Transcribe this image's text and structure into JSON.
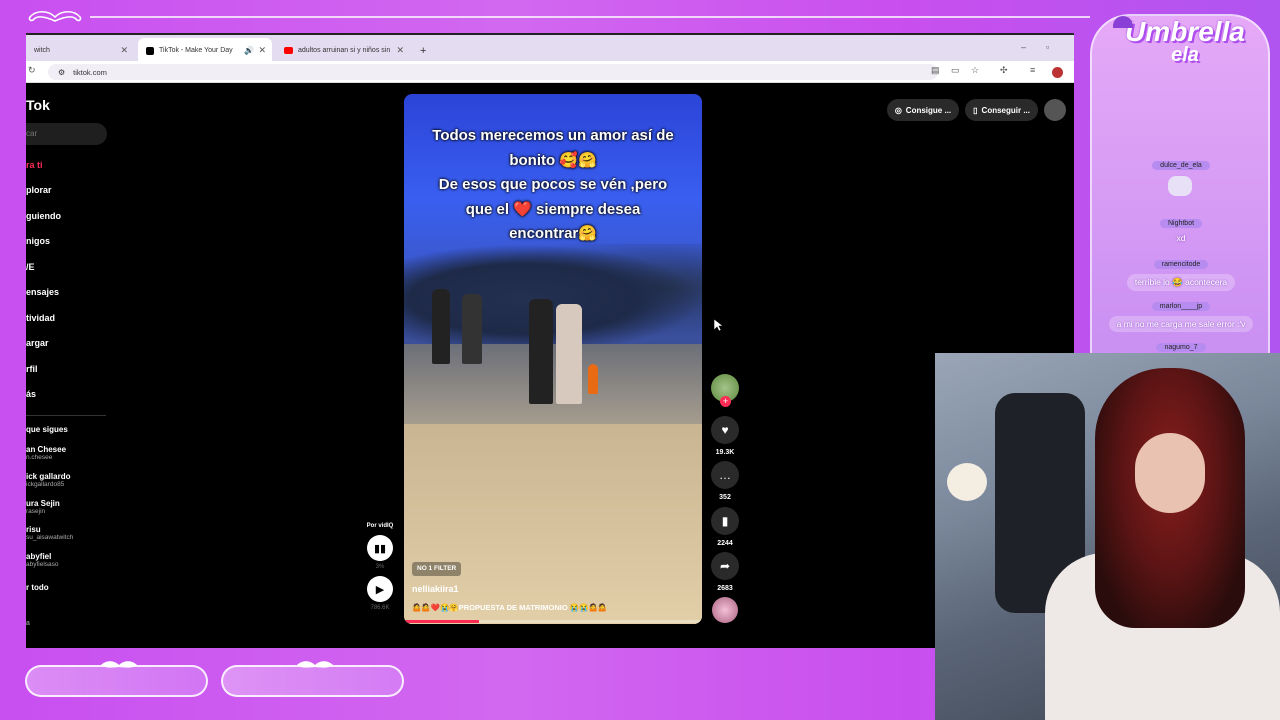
{
  "browser": {
    "tabs": [
      {
        "label": "witch"
      },
      {
        "label": "TikTok - Make Your Day"
      },
      {
        "label": "adultos arruinan si y niños sin"
      }
    ],
    "new_tab": "+",
    "url": "tiktok.com"
  },
  "tiktok": {
    "logo": "Tok",
    "search_placeholder": "car",
    "nav": [
      "ra ti",
      "plorar",
      "guiendo",
      "nigos",
      "/E",
      "ensajes",
      "tividad",
      "argar",
      "rfil",
      "ás"
    ],
    "following_header": "que sigues",
    "following": [
      {
        "name": "an Chesee",
        "handle": "n.chesee"
      },
      {
        "name": "ick gallardo",
        "handle": "ickgallardo85"
      },
      {
        "name": "ura Sejin",
        "handle": "rasejin"
      },
      {
        "name": "risu",
        "handle": "su_aisawatwitch"
      },
      {
        "name": "abyfiel",
        "handle": "abyfielsaso"
      }
    ],
    "see_all": "r todo",
    "footer": "a",
    "top_buttons": [
      "Consigue ...",
      "Conseguir ..."
    ],
    "video": {
      "caption_lines": [
        "Todos merecemos un amor así de",
        "bonito 🥰🤗",
        "De esos que pocos se vén ,pero",
        "que el ❤️ siempre desea",
        "encontrar🤗"
      ],
      "filter": "NO 1 FILTER",
      "username": "nelliakiira1",
      "description": "🤷🤷❤️😭🤗PROPUESTA DE MATRIMONIO 😭😭🤷🤷",
      "progress": 0.25
    },
    "actions": {
      "likes": "19.3K",
      "comments": "352",
      "saves": "2244",
      "shares": "2683"
    },
    "vidiq": {
      "label": "Por vidIQ",
      "percent": "3%",
      "views": "786.6K"
    }
  },
  "chat": {
    "brand_line1": "Umbrella",
    "brand_line2": "ela",
    "messages": [
      {
        "user": "dulce_de_ela",
        "text": "XD"
      },
      {
        "user": "Nightbot",
        "text": "xd"
      },
      {
        "user": "ramencitode",
        "text": "terrible lo 😂 acontecera"
      },
      {
        "user": "marlon____jp",
        "text": "a mi no me carga me sale error :'v"
      },
      {
        "user": "nagumo_7",
        "text": ""
      }
    ]
  },
  "colors": {
    "overlay_purple": "#c84ff0",
    "tiktok_red": "#fe2c55",
    "chat_pill": "#b78cf0"
  }
}
